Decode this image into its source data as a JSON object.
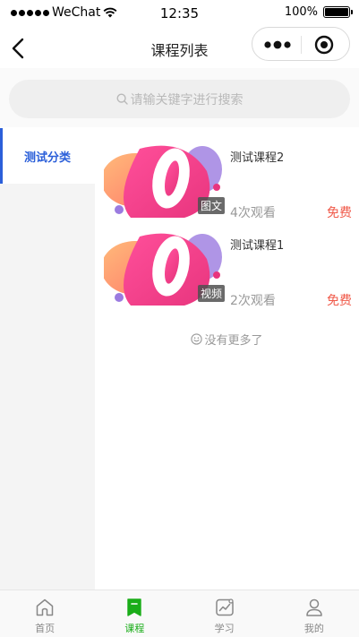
{
  "status_bar": {
    "carrier": "WeChat",
    "time": "12:35",
    "battery_percent": "100%",
    "battery_level": 1.0
  },
  "nav": {
    "title": "课程列表",
    "back_icon": "chevron-left-icon",
    "more_icon": "more-dots-icon",
    "close_icon": "target-icon"
  },
  "search": {
    "placeholder": "请输关键字进行搜索",
    "icon": "search-icon"
  },
  "categories": [
    {
      "label": "测试分类",
      "selected": true
    }
  ],
  "courses": [
    {
      "title": "测试课程2",
      "tag": "图文",
      "views": "4次观看",
      "price": "免费"
    },
    {
      "title": "测试课程1",
      "tag": "视频",
      "views": "2次观看",
      "price": "免费"
    }
  ],
  "list_end": {
    "text": "没有更多了",
    "icon": "smiley-icon"
  },
  "tabs": [
    {
      "label": "首页",
      "icon": "home-icon",
      "active": false
    },
    {
      "label": "课程",
      "icon": "bookmark-icon",
      "active": true
    },
    {
      "label": "学习",
      "icon": "chart-icon",
      "active": false
    },
    {
      "label": "我的",
      "icon": "user-icon",
      "active": false
    }
  ],
  "colors": {
    "accent_blue": "#2b5fd9",
    "tab_active_green": "#1aad19",
    "price_red": "#f05a4a",
    "muted_gray": "#999999"
  }
}
